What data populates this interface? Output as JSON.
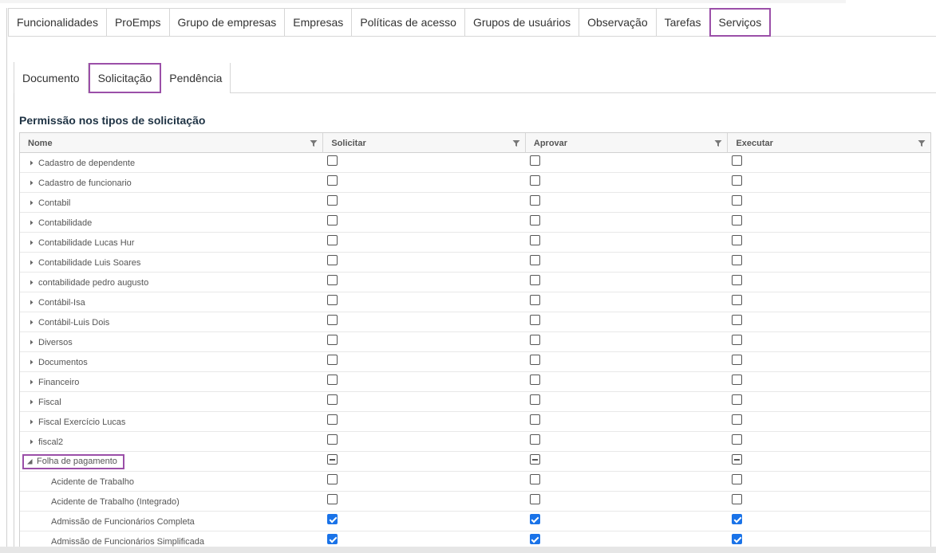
{
  "top_tabs": [
    {
      "label": "Funcionalidades",
      "active": false
    },
    {
      "label": "ProEmps",
      "active": false
    },
    {
      "label": "Grupo de empresas",
      "active": false
    },
    {
      "label": "Empresas",
      "active": false
    },
    {
      "label": "Políticas de acesso",
      "active": false
    },
    {
      "label": "Grupos de usuários",
      "active": false
    },
    {
      "label": "Observação",
      "active": false
    },
    {
      "label": "Tarefas",
      "active": false
    },
    {
      "label": "Serviços",
      "active": true
    }
  ],
  "sub_tabs": [
    {
      "label": "Documento",
      "active": false
    },
    {
      "label": "Solicitação",
      "active": true
    },
    {
      "label": "Pendência",
      "active": false
    }
  ],
  "section_title": "Permissão nos tipos de solicitação",
  "grid": {
    "columns": [
      "Nome",
      "Solicitar",
      "Aprovar",
      "Executar"
    ],
    "rows": [
      {
        "name": "Cadastro de dependente",
        "level": 0,
        "state": "collapsed",
        "values": [
          "unchecked",
          "unchecked",
          "unchecked"
        ]
      },
      {
        "name": "Cadastro de funcionario",
        "level": 0,
        "state": "collapsed",
        "values": [
          "unchecked",
          "unchecked",
          "unchecked"
        ]
      },
      {
        "name": "Contabil",
        "level": 0,
        "state": "collapsed",
        "values": [
          "unchecked",
          "unchecked",
          "unchecked"
        ]
      },
      {
        "name": "Contabilidade",
        "level": 0,
        "state": "collapsed",
        "values": [
          "unchecked",
          "unchecked",
          "unchecked"
        ]
      },
      {
        "name": "Contabilidade Lucas Hur",
        "level": 0,
        "state": "collapsed",
        "values": [
          "unchecked",
          "unchecked",
          "unchecked"
        ]
      },
      {
        "name": "Contabilidade Luis Soares",
        "level": 0,
        "state": "collapsed",
        "values": [
          "unchecked",
          "unchecked",
          "unchecked"
        ]
      },
      {
        "name": "contabilidade pedro augusto",
        "level": 0,
        "state": "collapsed",
        "values": [
          "unchecked",
          "unchecked",
          "unchecked"
        ]
      },
      {
        "name": "Contábil-Isa",
        "level": 0,
        "state": "collapsed",
        "values": [
          "unchecked",
          "unchecked",
          "unchecked"
        ]
      },
      {
        "name": "Contábil-Luis Dois",
        "level": 0,
        "state": "collapsed",
        "values": [
          "unchecked",
          "unchecked",
          "unchecked"
        ]
      },
      {
        "name": "Diversos",
        "level": 0,
        "state": "collapsed",
        "values": [
          "unchecked",
          "unchecked",
          "unchecked"
        ]
      },
      {
        "name": "Documentos",
        "level": 0,
        "state": "collapsed",
        "values": [
          "unchecked",
          "unchecked",
          "unchecked"
        ]
      },
      {
        "name": "Financeiro",
        "level": 0,
        "state": "collapsed",
        "values": [
          "unchecked",
          "unchecked",
          "unchecked"
        ]
      },
      {
        "name": "Fiscal",
        "level": 0,
        "state": "collapsed",
        "values": [
          "unchecked",
          "unchecked",
          "unchecked"
        ]
      },
      {
        "name": "Fiscal Exercício Lucas",
        "level": 0,
        "state": "collapsed",
        "values": [
          "unchecked",
          "unchecked",
          "unchecked"
        ]
      },
      {
        "name": "fiscal2",
        "level": 0,
        "state": "collapsed",
        "values": [
          "unchecked",
          "unchecked",
          "unchecked"
        ]
      },
      {
        "name": "Folha de pagamento",
        "level": 0,
        "state": "expanded",
        "values": [
          "partial",
          "partial",
          "partial"
        ]
      },
      {
        "name": "Acidente de Trabalho",
        "level": 1,
        "state": "leaf",
        "values": [
          "unchecked",
          "unchecked",
          "unchecked"
        ]
      },
      {
        "name": "Acidente de Trabalho (Integrado)",
        "level": 1,
        "state": "leaf",
        "values": [
          "unchecked",
          "unchecked",
          "unchecked"
        ]
      },
      {
        "name": "Admissão de Funcionários Completa",
        "level": 1,
        "state": "leaf",
        "values": [
          "checked",
          "checked",
          "checked"
        ]
      },
      {
        "name": "Admissão de Funcionários Simplificada",
        "level": 1,
        "state": "leaf",
        "values": [
          "checked",
          "checked",
          "checked"
        ]
      }
    ]
  },
  "icons": {
    "filter": "filter-icon",
    "expand": "caret-right-icon",
    "collapse": "caret-down-icon"
  },
  "colors": {
    "highlight": "#9b4fa8",
    "checkbox_checked": "#1a73e8",
    "title": "#1f3344"
  }
}
